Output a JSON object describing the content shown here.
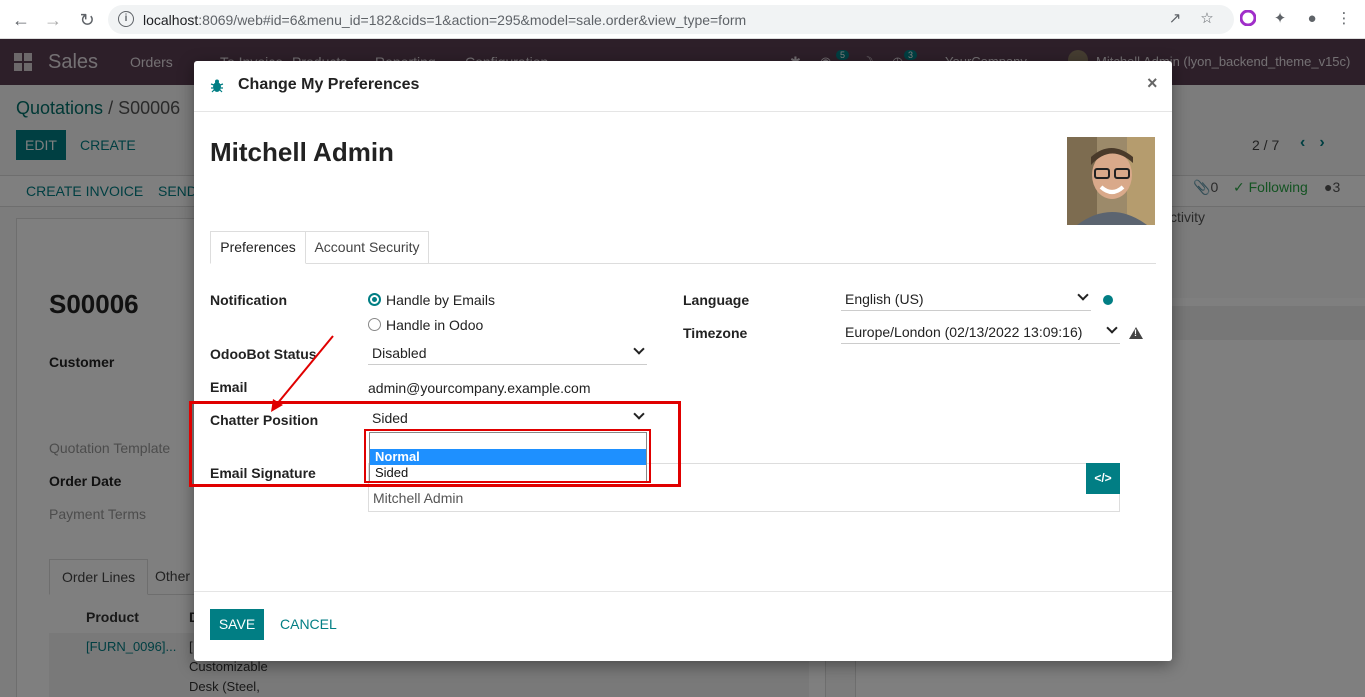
{
  "browser": {
    "url_host": "localhost",
    "url_path": ":8069/web#id=6&menu_id=182&cids=1&action=295&model=sale.order&view_type=form"
  },
  "navbar": {
    "app_name": "Sales",
    "menus": [
      "Orders",
      "To Invoice",
      "Products",
      "Reporting",
      "Configuration"
    ],
    "badge_chat": "5",
    "badge_activity": "3",
    "company": "YourCompany",
    "user": "Mitchell Admin (lyon_backend_theme_v15c)"
  },
  "page": {
    "breadcrumb_root": "Quotations",
    "breadcrumb_sep": " / ",
    "breadcrumb_current": "S00006",
    "edit_label": "EDIT",
    "create_label": "CREATE",
    "pager": "2 / 7",
    "create_invoice_label": "CREATE INVOICE",
    "send_label": "SEND",
    "attachments_count": "0",
    "following_label": "Following",
    "followers_count": "3",
    "activity_label": "ctivity",
    "order_name": "S00006",
    "customer_label": "Customer",
    "quotation_template_label": "Quotation Template",
    "order_date_label": "Order Date",
    "payment_terms_label": "Payment Terms",
    "tab_order_lines": "Order Lines",
    "tab_other": "Other I",
    "col_product": "Product",
    "col_description": "D",
    "line_product": "[FURN_0096]...",
    "line_desc_1": "[",
    "line_desc_2": "Customizable",
    "line_desc_3": "Desk (Steel,"
  },
  "modal": {
    "title": "Change My Preferences",
    "close": "×",
    "user_name": "Mitchell Admin",
    "tabs": [
      "Preferences",
      "Account Security"
    ],
    "notification_label": "Notification",
    "notification_options": [
      "Handle by Emails",
      "Handle in Odoo"
    ],
    "odoobot_label": "OdooBot Status",
    "odoobot_value": "Disabled",
    "email_label": "Email",
    "email_value": "admin@yourcompany.example.com",
    "chatter_label": "Chatter Position",
    "chatter_value": "Sided",
    "chatter_options": [
      "Normal",
      "Sided"
    ],
    "signature_label": "Email Signature",
    "signature_value": "Mitchell Admin",
    "code_label": "</>",
    "language_label": "Language",
    "language_value": "English (US)",
    "timezone_label": "Timezone",
    "timezone_value": "Europe/London (02/13/2022 13:09:16)",
    "save_label": "SAVE",
    "cancel_label": "CANCEL"
  },
  "colors": {
    "primary": "#017e84",
    "navbar": "#5a3e52",
    "highlight": "#e00000",
    "dropdown_selected": "#1e90ff"
  }
}
